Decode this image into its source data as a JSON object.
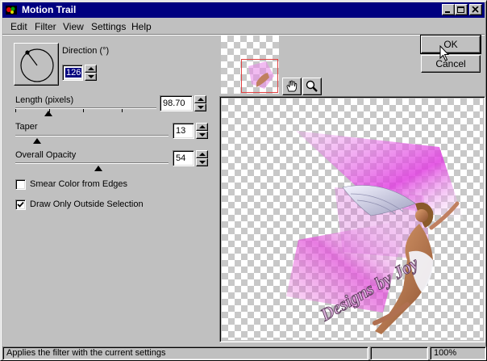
{
  "window": {
    "title": "Motion Trail"
  },
  "menu": {
    "edit": "Edit",
    "filter": "Filter",
    "view": "View",
    "settings": "Settings",
    "help": "Help"
  },
  "direction": {
    "label": "Direction (°)",
    "value": "126"
  },
  "length": {
    "label": "Length (pixels)",
    "value": "98.70",
    "level_percent": 23
  },
  "taper": {
    "label": "Taper",
    "value": "13",
    "level_percent": 13
  },
  "opacity": {
    "label": "Overall Opacity",
    "value": "54",
    "level_percent": 54
  },
  "options": {
    "smear_label": "Smear Color from Edges",
    "smear_checked": false,
    "draw_outside_label": "Draw Only Outside Selection",
    "draw_outside_checked": true
  },
  "buttons": {
    "ok": "OK",
    "cancel": "Cancel"
  },
  "preview": {
    "watermark": "Designs by Joy"
  },
  "status": {
    "message": "Applies the filter with the current settings",
    "zoom": "100%"
  },
  "colors": {
    "titlebar": "#000080",
    "face": "#c0c0c0",
    "trail": "#e040e0",
    "frame": "#e04040"
  },
  "icons": [
    "app-icon",
    "minimize-icon",
    "maximize-icon",
    "close-icon",
    "hand-pan-icon",
    "zoom-magnifier-icon",
    "direction-dial-icon",
    "checkmark-icon"
  ]
}
